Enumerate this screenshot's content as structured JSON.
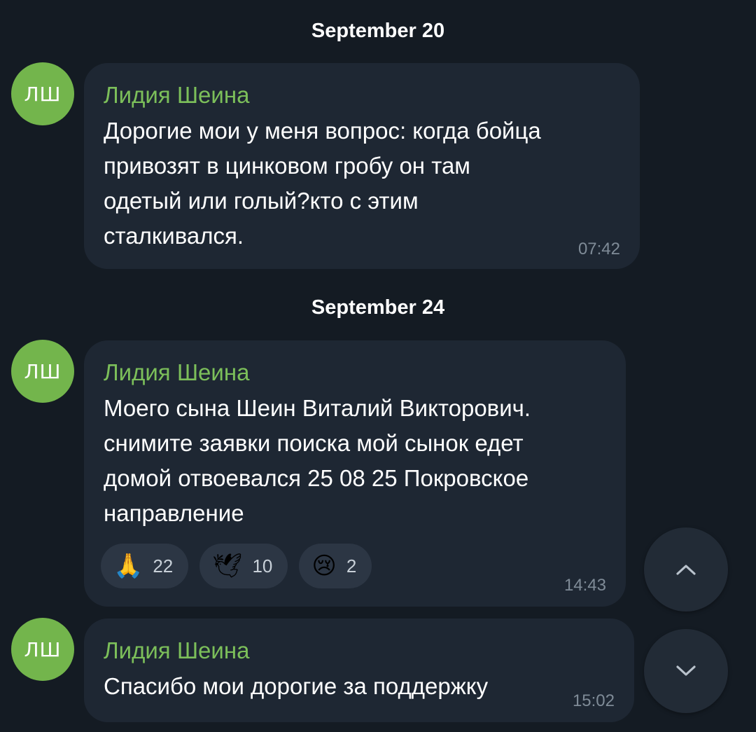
{
  "dates": {
    "sep20": "September 20",
    "sep24": "September 24"
  },
  "avatar_initials": "ЛШ",
  "messages": [
    {
      "sender": "Лидия Шеина",
      "text": "Дорогие мои у меня вопрос: когда бойца\nпривозят в цинковом гробу он там\nодетый или голый?кто с этим\nсталкивался.",
      "time": "07:42"
    },
    {
      "sender": "Лидия Шеина",
      "text": "Моего сына Шеин Виталий Викторович.\nснимите заявки поиска мой сынок едет\nдомой отвоевался 25 08 25 Покровское\nнаправление",
      "time": "14:43",
      "reactions": [
        {
          "emoji": "🙏",
          "icon": "praying-hands-icon",
          "count": "22"
        },
        {
          "emoji": "🕊",
          "icon": "dove-icon",
          "count": "10"
        },
        {
          "emoji": "😢",
          "icon": "crying-face-icon",
          "count": "2"
        }
      ]
    },
    {
      "sender": "Лидия Шеина",
      "text": "Спасибо мои дорогие за поддержку",
      "time": "15:02"
    }
  ],
  "buttons": {
    "scroll_up_icon": "chevron-up-icon",
    "scroll_down_icon": "chevron-down-icon"
  },
  "colors": {
    "background": "#141b23",
    "bubble": "#1e2733",
    "sender_name": "#7cbf5a",
    "avatar": "#73b54c",
    "time": "#7f8b97"
  }
}
